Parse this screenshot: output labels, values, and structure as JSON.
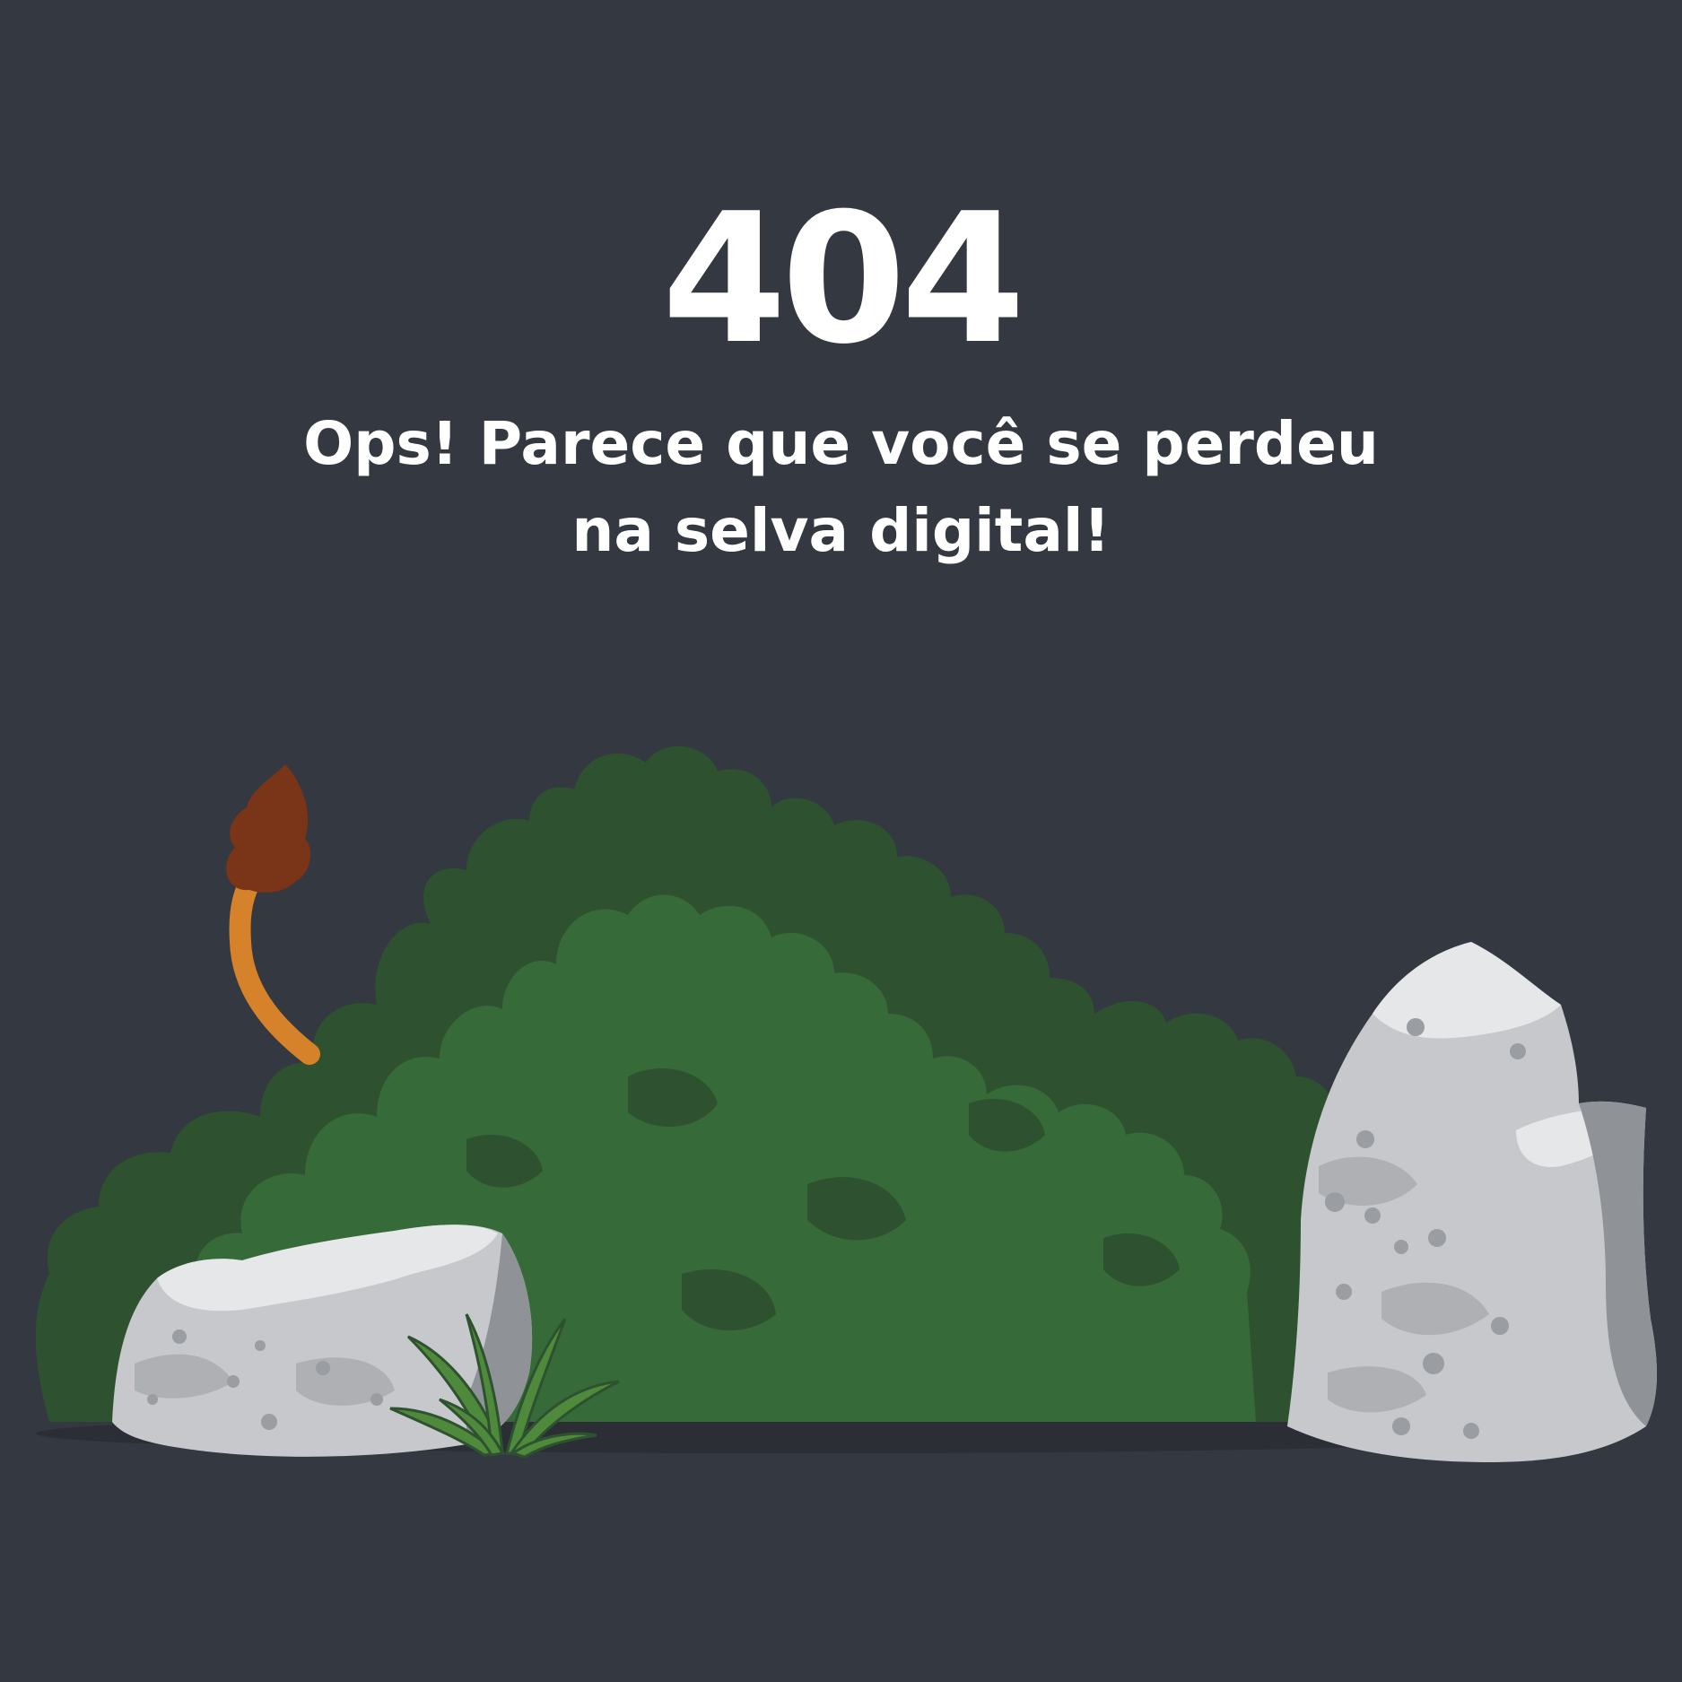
{
  "error": {
    "code": "404",
    "message_lines": [
      "Ops! Parece que você se perdeu",
      "na selva digital!"
    ]
  },
  "scene": {
    "illustration": "jungle-bush-with-rocks-and-hidden-animal-tail",
    "colors": {
      "background": "#343841",
      "bush_dark": "#2e5230",
      "bush_light": "#366b39",
      "rock_light": "#e6e7e8",
      "rock_mid": "#c6c8cb",
      "rock_dark": "#8f9296",
      "tail": "#d5822a",
      "tail_tuft": "#7a3418",
      "grass": "#4f8a3c"
    }
  }
}
